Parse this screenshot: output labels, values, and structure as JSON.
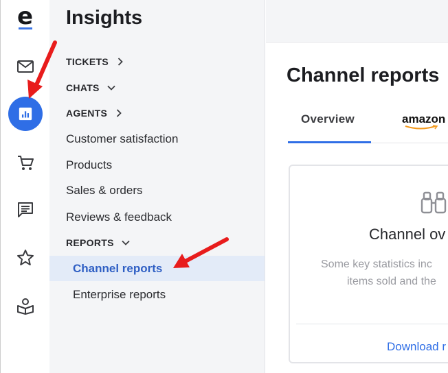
{
  "rail": {
    "logo": "e",
    "icons": [
      "mail-icon",
      "insights-icon",
      "cart-icon",
      "chat-icon",
      "star-icon",
      "book-user-icon"
    ],
    "accent": "#2f6ee6"
  },
  "sidebar": {
    "title": "Insights",
    "items": [
      {
        "label": "TICKETS",
        "type": "section",
        "chevron": "right"
      },
      {
        "label": "CHATS",
        "type": "section",
        "chevron": "down"
      },
      {
        "label": "AGENTS",
        "type": "section",
        "chevron": "right"
      },
      {
        "label": "Customer satisfaction",
        "type": "link"
      },
      {
        "label": "Products",
        "type": "link"
      },
      {
        "label": "Sales & orders",
        "type": "link"
      },
      {
        "label": "Reviews & feedback",
        "type": "link"
      },
      {
        "label": "REPORTS",
        "type": "section",
        "chevron": "down"
      }
    ],
    "sub_items": [
      {
        "label": "Channel reports",
        "active": true
      },
      {
        "label": "Enterprise reports",
        "active": false
      }
    ]
  },
  "main": {
    "title": "Channel reports",
    "tabs": [
      {
        "label": "Overview",
        "active": true
      },
      {
        "label": "amazon",
        "logo": true
      }
    ],
    "card": {
      "title": "Channel ov",
      "text_line1": "Some key statistics inc",
      "text_line2": "items sold and the",
      "link": "Download r"
    }
  },
  "annotation_color": "#e81c1c"
}
